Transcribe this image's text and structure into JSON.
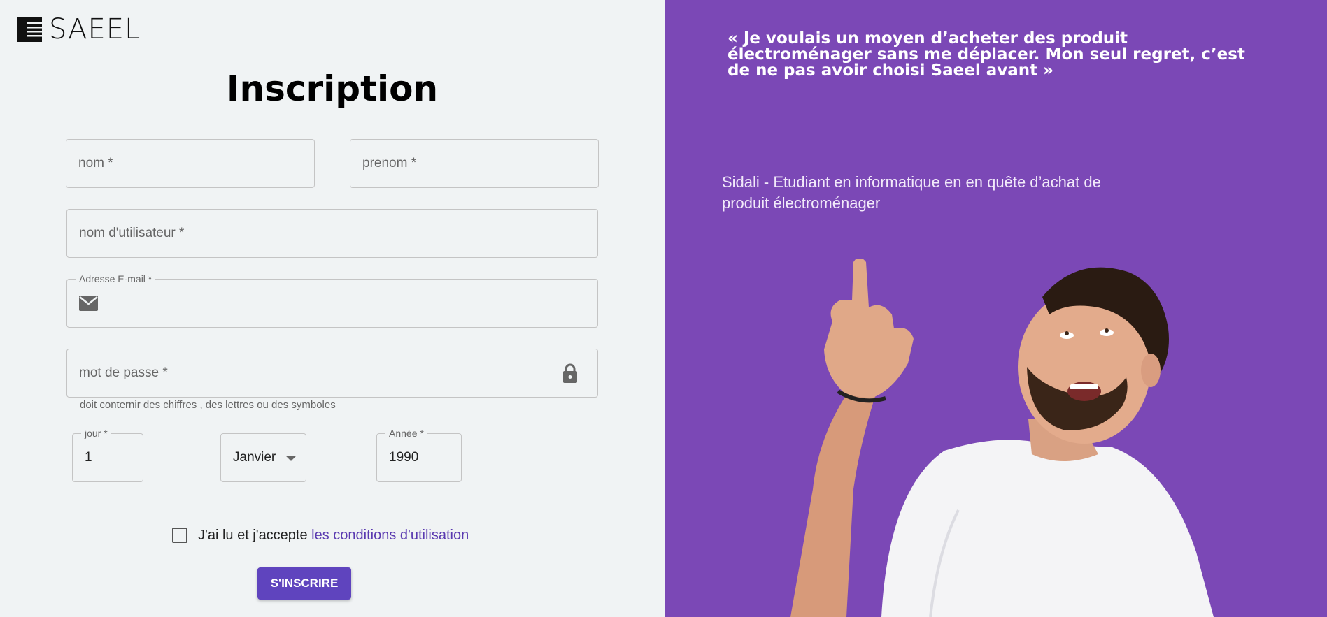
{
  "brand": {
    "name": "SAEEL"
  },
  "form": {
    "title": "Inscription",
    "nom_placeholder": "nom *",
    "prenom_placeholder": "prenom *",
    "username_placeholder": "nom d'utilisateur *",
    "email_label": "Adresse E-mail *",
    "password_placeholder": "mot de passe *",
    "password_helper": "doit conternir des chiffres , des lettres ou des symboles",
    "day_label": "jour *",
    "day_value": "1",
    "month_value": "Janvier",
    "year_label": "Année *",
    "year_value": "1990",
    "terms_prefix": "J'ai lu et j'accepte ",
    "terms_link": "les conditions d'utilisation",
    "submit_label": "S'INSCRIRE"
  },
  "testimonial": {
    "quote": "« Je voulais un moyen d’acheter des produit électroménager sans me déplacer. Mon seul regret, c’est de ne pas avoir choisi Saeel avant »",
    "author": "Sidali - Etudiant en informatique en en quête d’achat de produit électroménager"
  },
  "icons": [
    "logo-icon",
    "mail-icon",
    "lock-icon",
    "dropdown-arrow-icon"
  ],
  "colors": {
    "accent": "#5f44be",
    "panel": "#7b48b6",
    "background": "#f0f3f4"
  }
}
